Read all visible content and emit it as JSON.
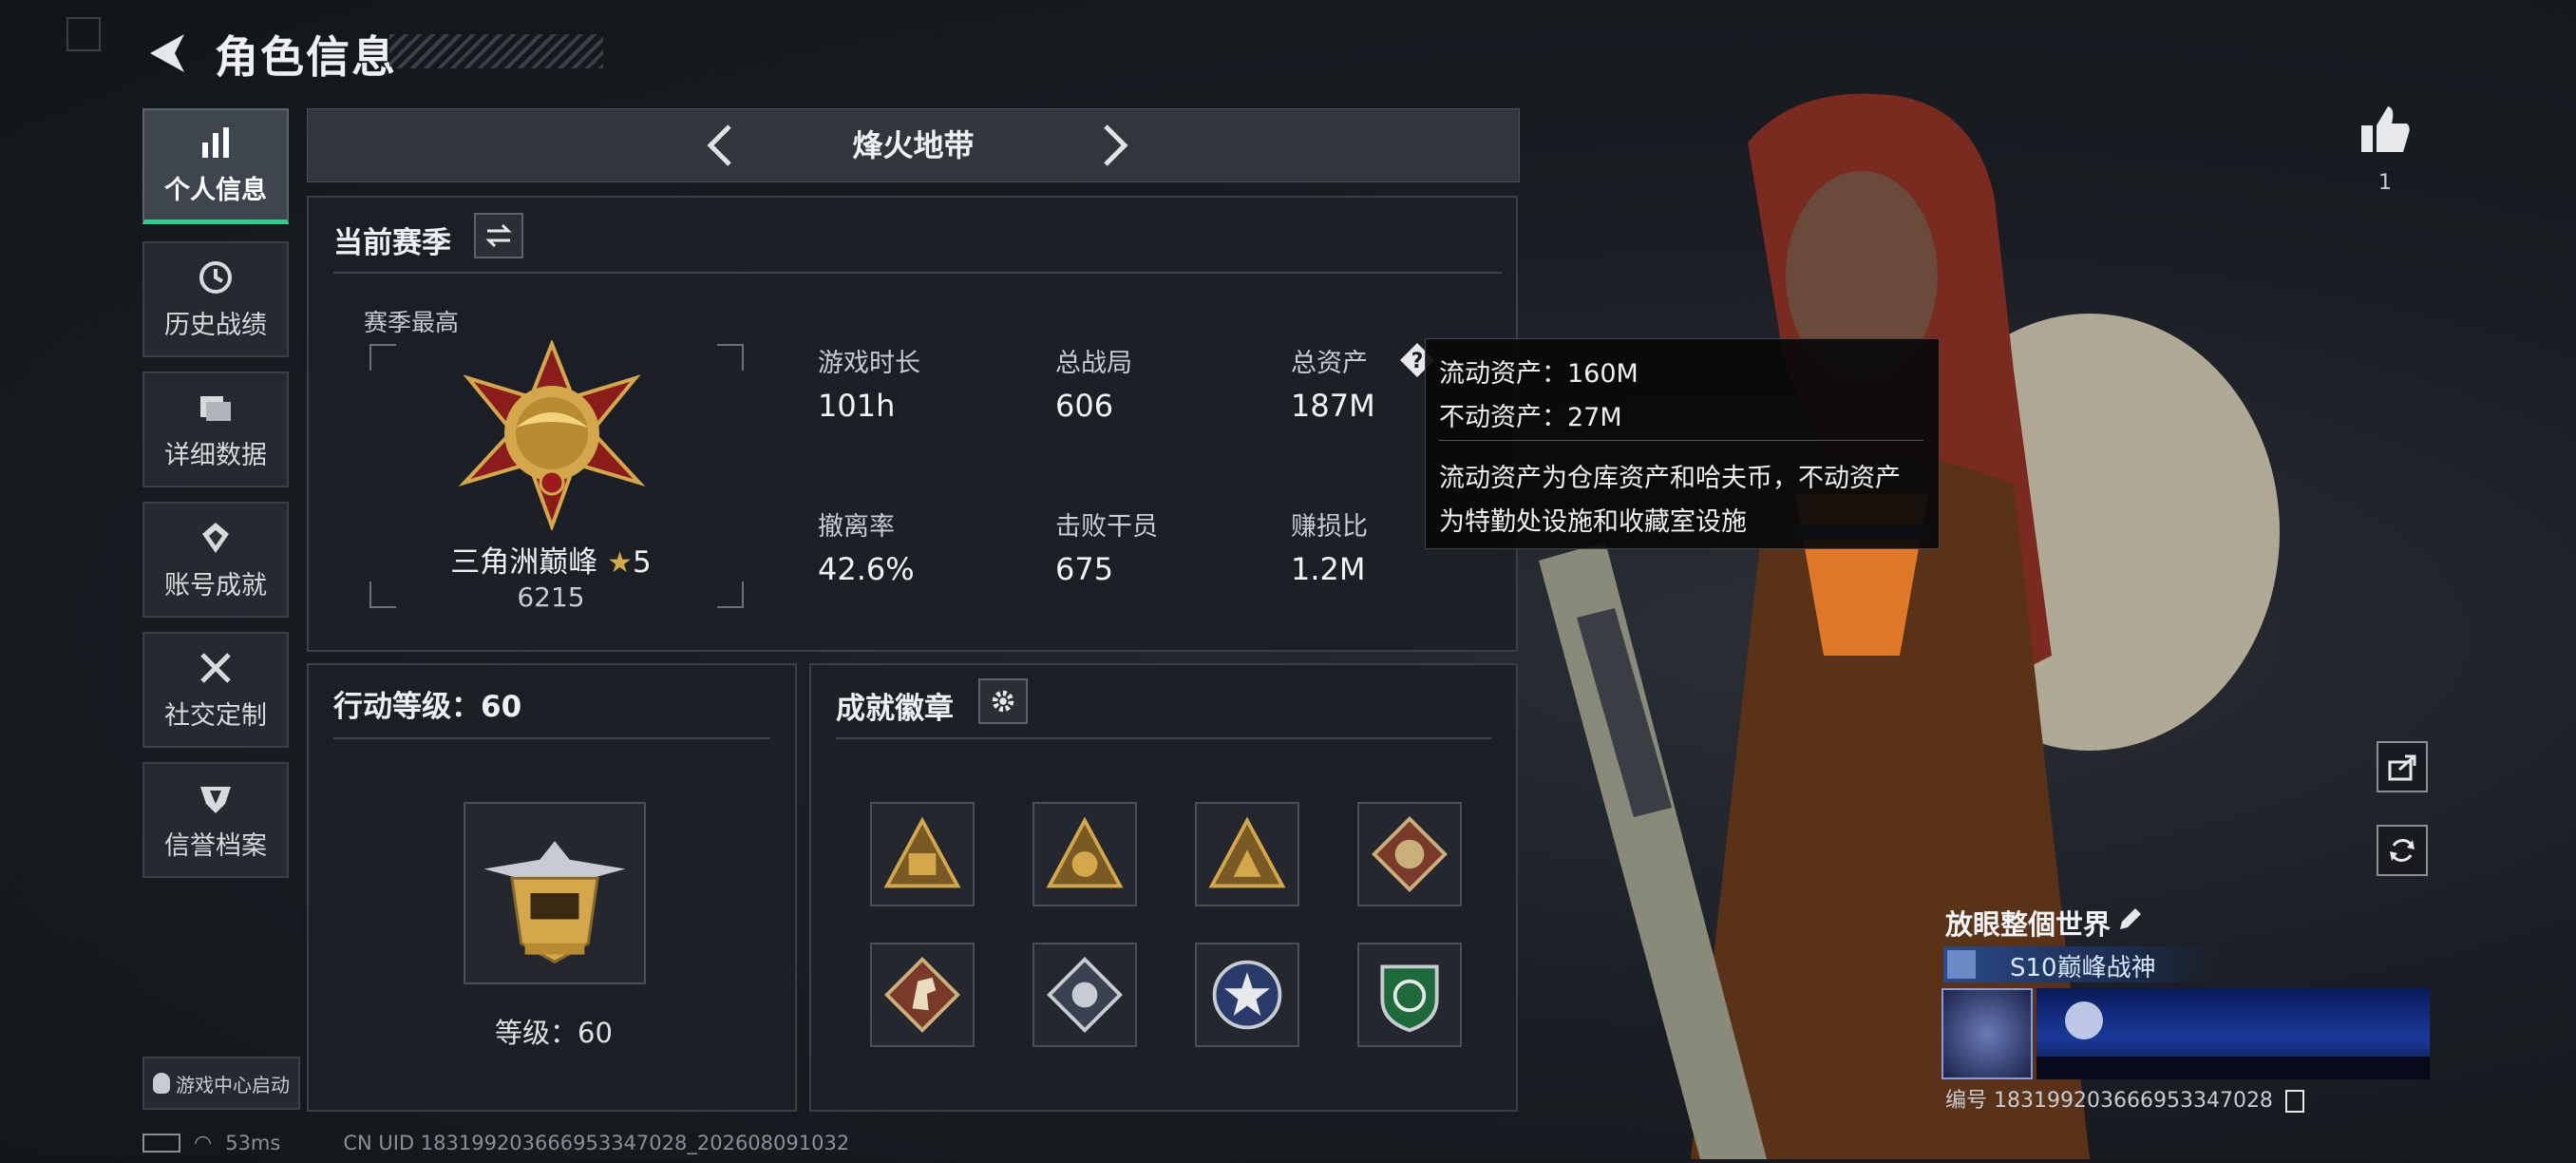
{
  "header": {
    "title": "角色信息"
  },
  "sidebar": {
    "items": [
      {
        "label": "个人信息",
        "icon": "bar-chart-icon",
        "active": true
      },
      {
        "label": "历史战绩",
        "icon": "history-icon"
      },
      {
        "label": "详细数据",
        "icon": "folder-icon"
      },
      {
        "label": "账号成就",
        "icon": "achievement-icon"
      },
      {
        "label": "社交定制",
        "icon": "tools-icon"
      },
      {
        "label": "信誉档案",
        "icon": "shield-icon"
      }
    ],
    "launch_label": "游戏中心启动"
  },
  "mode": {
    "title": "烽火地带"
  },
  "season": {
    "title": "当前赛季",
    "best_label": "赛季最高",
    "rank_name": "三角洲巅峰",
    "rank_stars": "5",
    "rank_score": "6215",
    "stats": [
      {
        "label": "游戏时长",
        "value": "101h"
      },
      {
        "label": "总战局",
        "value": "606"
      },
      {
        "label": "总资产",
        "value": "187M"
      },
      {
        "label": "撤离率",
        "value": "42.6%"
      },
      {
        "label": "击败干员",
        "value": "675"
      },
      {
        "label": "赚损比",
        "value": "1.2M"
      }
    ]
  },
  "tooltip": {
    "line1": "流动资产：160M",
    "line2": "不动资产：27M",
    "desc1": "流动资产为仓库资产和哈夫币，不动资产",
    "desc2": "为特勤处设施和收藏室设施"
  },
  "action_level": {
    "title": "行动等级：60",
    "level_label": "等级：60"
  },
  "badges": {
    "title": "成就徽章",
    "count": 8
  },
  "like": {
    "count": "1"
  },
  "profile": {
    "name": "放眼整個世界",
    "title_tag": "S10巅峰战神",
    "id_line": "编号 1831992036669533470​28"
  },
  "status_bar": {
    "ping": "53ms",
    "uid": "CN UID 1831992036669533470​28_202608091032"
  },
  "colors": {
    "accent_green": "#2ccf8a",
    "gold": "#d4a84a"
  }
}
